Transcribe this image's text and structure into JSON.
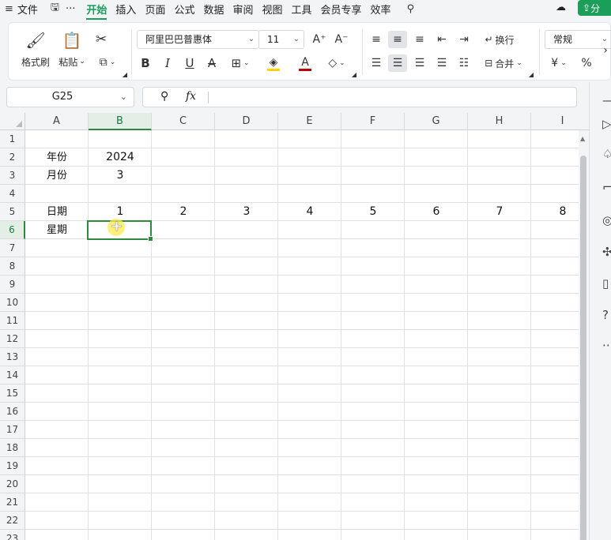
{
  "menubar": {
    "menu_icon": "≡",
    "file": "文件",
    "more": "···",
    "tabs": [
      "开始",
      "插入",
      "页面",
      "公式",
      "数据",
      "审阅",
      "视图",
      "工具",
      "会员专享",
      "效率"
    ],
    "share": "分"
  },
  "ribbon": {
    "format_painter": "格式刷",
    "paste": "粘贴",
    "font_name": "阿里巴巴普惠体",
    "font_size": "11",
    "wrap_text": "换行",
    "merge": "合并",
    "number_format": "常规",
    "percent": "%",
    "currency": "¥"
  },
  "formula_bar": {
    "name_box": "G25",
    "fx": "fx",
    "value": ""
  },
  "sheet": {
    "columns": [
      "A",
      "B",
      "C",
      "D",
      "E",
      "F",
      "G",
      "H",
      "I"
    ],
    "rows": [
      "1",
      "2",
      "3",
      "4",
      "5",
      "6",
      "7",
      "8",
      "9",
      "10",
      "11",
      "12",
      "13",
      "14",
      "15",
      "16",
      "17",
      "18",
      "19",
      "20",
      "21",
      "22",
      "23"
    ],
    "cells": {
      "A2": "年份",
      "B2": "2024",
      "A3": "月份",
      "B3": "3",
      "A5": "日期",
      "B5": "1",
      "C5": "2",
      "D5": "3",
      "E5": "4",
      "F5": "5",
      "G5": "6",
      "H5": "7",
      "I5": "8",
      "A6": "星期"
    }
  },
  "colors": {
    "accent": "#1a9e5a",
    "selection": "#2e8b3d",
    "font_color_bar": "#c00000",
    "fill_color_bar": "#ffd400"
  }
}
